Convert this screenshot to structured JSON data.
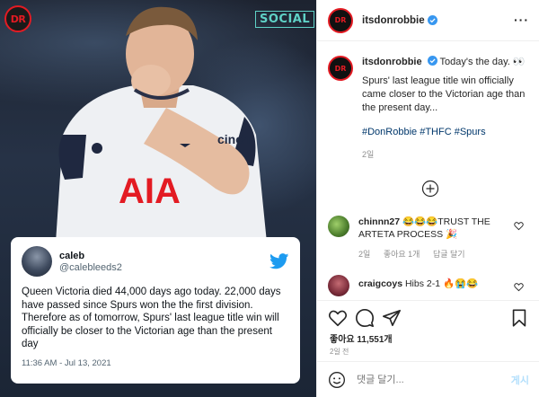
{
  "media": {
    "watermark": "DR",
    "social_tag": "SOCIAL",
    "jersey_sponsor": "AIA",
    "sleeve_sponsor": "cinch",
    "tweet": {
      "name": "caleb",
      "handle": "@calebleeds2",
      "text": "Queen Victoria died 44,000 days ago today. 22,000 days have passed since Spurs won the the first division. Therefore as of tomorrow, Spurs' last league title win will officially be closer to the Victorian age than the present day",
      "timestamp": "11:36 AM - Jul 13, 2021"
    }
  },
  "header": {
    "username": "itsdonrobbie",
    "avatar_text": "DR",
    "more_label": "···"
  },
  "caption": {
    "username": "itsdonrobbie",
    "headline": "Today's the day. 👀",
    "body": "Spurs' last league title win officially came closer to the Victorian age than the present day...",
    "hashtags": "#DonRobbie #THFC #Spurs",
    "time": "2일"
  },
  "comments": [
    {
      "username": "chinnn27",
      "text": "😂😂😂TRUST THE ARTETA PROCESS 🎉",
      "time": "2일",
      "likes": "좋아요 1개",
      "reply": "답글 달기"
    },
    {
      "username": "craigcoys",
      "text": "Hibs 2-1 🔥😭😂"
    }
  ],
  "actions": {
    "likes": "좋아요 11,551개",
    "date": "2일 전"
  },
  "add_comment": {
    "placeholder": "댓글 달기...",
    "post_label": "게시"
  },
  "colors": {
    "accent": "#e31b23",
    "link": "#00376b",
    "verified": "#3897f0",
    "twitter": "#1d9bf0",
    "social": "#5fd1c6"
  }
}
